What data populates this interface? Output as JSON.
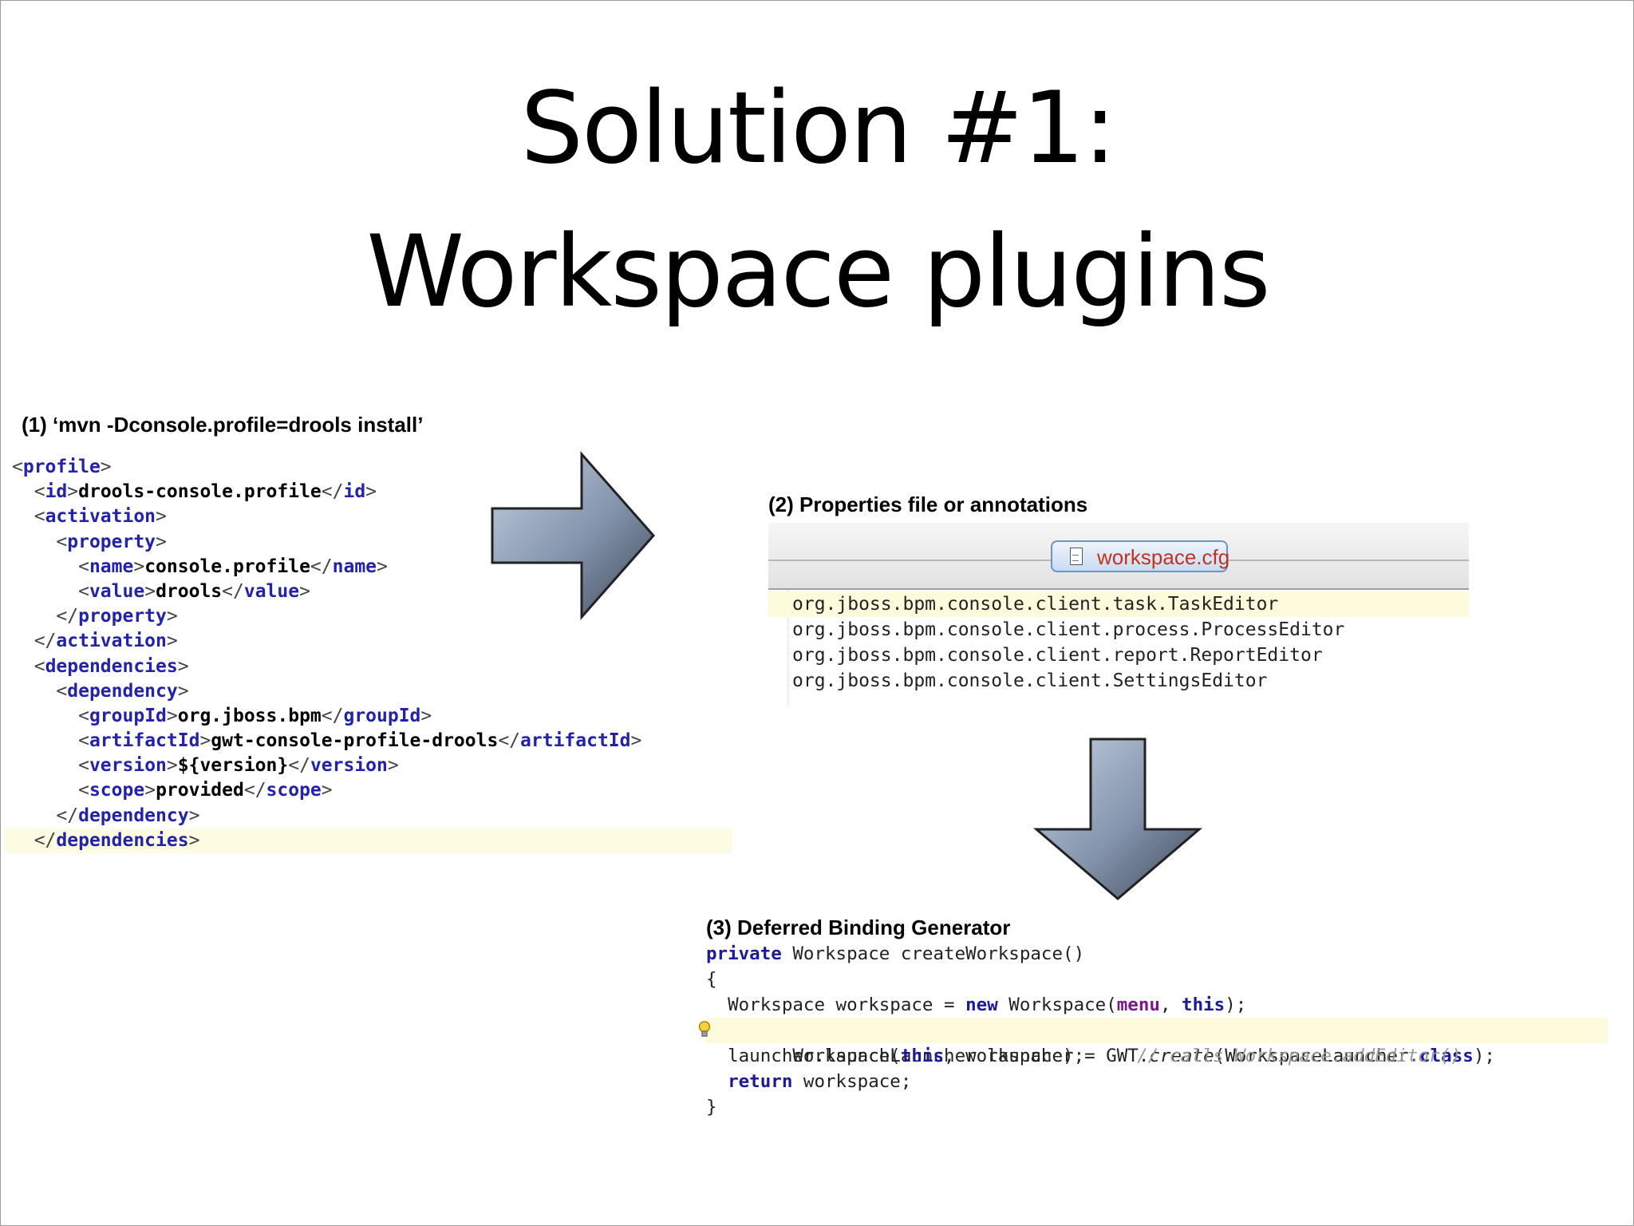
{
  "title": {
    "line1": "Solution #1:",
    "line2": "Workspace plugins"
  },
  "step1": {
    "label": "(1) ‘mvn -Dconsole.profile=drools install’",
    "xml_lines": [
      {
        "open": "profile"
      },
      {
        "open": "id",
        "text": "drools-console.profile",
        "close": "id"
      },
      {
        "open": "activation"
      },
      {
        "open": "property"
      },
      {
        "open": "name",
        "text": "console.profile",
        "close": "name"
      },
      {
        "open": "value",
        "text": "drools",
        "close": "value"
      },
      {
        "close": "property"
      },
      {
        "close": "activation"
      },
      {
        "open": "dependencies"
      },
      {
        "open": "dependency"
      },
      {
        "open": "groupId",
        "text": "org.jboss.bpm",
        "close": "groupId"
      },
      {
        "open": "artifactId",
        "text": "gwt-console-profile-drools",
        "close": "artifactId"
      },
      {
        "open": "version",
        "text": "${version}",
        "close": "version"
      },
      {
        "open": "scope",
        "text": "provided",
        "close": "scope"
      },
      {
        "close": "dependency"
      },
      {
        "close": "dependencies"
      }
    ]
  },
  "step2": {
    "label": "(2) Properties file or annotations",
    "tab_label": "workspace.cfg",
    "tab_icon": "document-icon",
    "lines": [
      "org.jboss.bpm.console.client.task.TaskEditor",
      "org.jboss.bpm.console.client.process.ProcessEditor",
      "org.jboss.bpm.console.client.report.ReportEditor",
      "org.jboss.bpm.console.client.SettingsEditor"
    ]
  },
  "step3": {
    "label": "(3) Deferred Binding Generator",
    "code": {
      "l1_kw": "private",
      "l1_rest": " Workspace createWorkspace()",
      "l2": "{",
      "l3_a": "  Workspace workspace = ",
      "l3_kw": "new",
      "l3_b": " Workspace(",
      "l3_fld": "menu",
      "l3_c": ", ",
      "l3_kw2": "this",
      "l3_d": ");",
      "l4_a": "  WorkspaceLauncher launcher = GWT.",
      "l4_it": "create",
      "l4_b": "(WorkspaceLauncher.",
      "l4_kw": "class",
      "l4_c": ");",
      "l5_a": "  launcher.launch(",
      "l5_kw": "this",
      "l5_b": ", workspace);",
      "l5_cm": "// calls Workspace.addEditor()",
      "l6_kw": "return",
      "l6_b": " workspace;",
      "l7": "}"
    }
  },
  "colors": {
    "xml_tag": "#2222aa",
    "java_keyword": "#1a1a9a",
    "java_field": "#7a1a8a",
    "highlight_line": "#fdfbdc",
    "arrow_fill_light": "#a9b8cf",
    "arrow_fill_dark": "#4e596c"
  }
}
